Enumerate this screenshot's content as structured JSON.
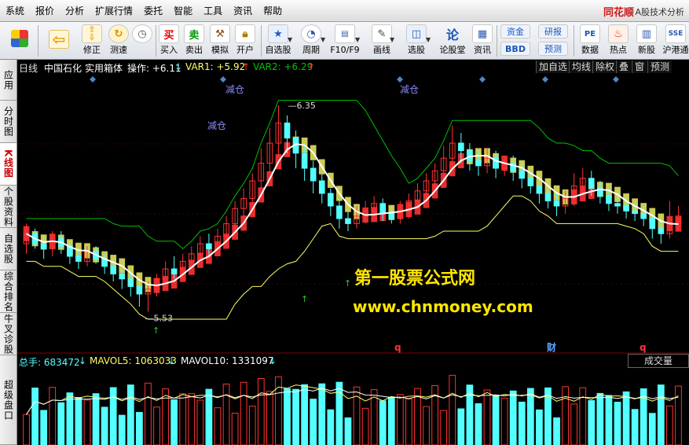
{
  "menu": [
    "系统",
    "报价",
    "分析",
    "扩展行情",
    "委托",
    "智能",
    "工具",
    "资讯",
    "帮助"
  ],
  "brand": {
    "name": "同花顺",
    "subtitle": "- A股技术分析"
  },
  "toolbar": [
    {
      "label": "",
      "icon": "grid-icon"
    },
    {
      "label": "",
      "icon": "back-arrow-icon"
    },
    {
      "label": "修正",
      "icon": "up-down-arrow-icon"
    },
    {
      "label": "测速",
      "icon": "refresh-icon"
    },
    {
      "label": "",
      "icon": "clock-icon"
    },
    {
      "label": "买入",
      "icon": "buy-icon",
      "glyph": "买"
    },
    {
      "label": "卖出",
      "icon": "sell-icon",
      "glyph": "卖"
    },
    {
      "label": "模拟",
      "icon": "hammer-icon"
    },
    {
      "label": "开户",
      "icon": "lock-icon"
    },
    {
      "label": "自选股",
      "icon": "star-icon"
    },
    {
      "label": "周期",
      "icon": "period-icon"
    },
    {
      "label": "F10/F9",
      "icon": "f10-icon"
    },
    {
      "label": "画线",
      "icon": "pen-icon"
    },
    {
      "label": "选股",
      "icon": "stock-picker-icon"
    },
    {
      "label": "论股堂",
      "icon": "forum-icon",
      "glyph": "论"
    },
    {
      "label": "资讯",
      "icon": "news-icon"
    },
    {
      "label": "资金",
      "icon": "funds-icon"
    },
    {
      "label": "BBD",
      "icon": "bbd-icon"
    },
    {
      "label": "研报",
      "icon": "research-icon"
    },
    {
      "label": "预测",
      "icon": "forecast-icon"
    },
    {
      "label": "数据",
      "icon": "pe-data-icon",
      "glyph": "PE"
    },
    {
      "label": "热点",
      "icon": "hot-icon"
    },
    {
      "label": "新股",
      "icon": "new-stock-icon"
    },
    {
      "label": "沪港通",
      "icon": "hk-connect-icon"
    }
  ],
  "left_tabs": [
    {
      "label": "应用"
    },
    {
      "label": "分时图"
    },
    {
      "label": "K线图",
      "active": true
    },
    {
      "label": "个股资料"
    },
    {
      "label": "自选股"
    },
    {
      "label": "综合排名"
    },
    {
      "label": "牛叉诊股"
    },
    {
      "label": "超级盘口"
    }
  ],
  "chart": {
    "period": "日线",
    "stock_name": "中国石化",
    "indicator": "实用箱体",
    "operation": "操作: +6.11",
    "var1": "VAR1: +5.92",
    "var2": "VAR2: +6.29",
    "buttons": [
      "加自选",
      "均线",
      "除权",
      "叠",
      "窗",
      "预测"
    ],
    "high_label": "6.35",
    "low_label": "5.53",
    "annotations": [
      "减仓",
      "减仓",
      "减仓"
    ],
    "events": [
      "q",
      "财",
      "q"
    ],
    "colors": {
      "up": "#ff3232",
      "down": "#54ffff",
      "ma": "#ffffff",
      "box": "#ffff66",
      "var2": "#00c000"
    }
  },
  "chart_data": {
    "type": "candlestick",
    "price_range": [
      5.4,
      6.45
    ],
    "candles": [
      [
        5.8,
        5.84,
        5.76,
        5.88
      ],
      [
        5.84,
        5.8,
        5.78,
        5.86
      ],
      [
        5.8,
        5.78,
        5.74,
        5.83
      ],
      [
        5.78,
        5.82,
        5.75,
        5.85
      ],
      [
        5.82,
        5.79,
        5.76,
        5.85
      ],
      [
        5.79,
        5.75,
        5.72,
        5.81
      ],
      [
        5.75,
        5.73,
        5.7,
        5.78
      ],
      [
        5.73,
        5.77,
        5.71,
        5.79
      ],
      [
        5.77,
        5.74,
        5.72,
        5.79
      ],
      [
        5.74,
        5.71,
        5.68,
        5.76
      ],
      [
        5.71,
        5.68,
        5.65,
        5.74
      ],
      [
        5.68,
        5.66,
        5.62,
        5.7
      ],
      [
        5.66,
        5.63,
        5.59,
        5.69
      ],
      [
        5.63,
        5.6,
        5.55,
        5.66
      ],
      [
        5.6,
        5.62,
        5.53,
        5.65
      ],
      [
        5.62,
        5.66,
        5.59,
        5.68
      ],
      [
        5.66,
        5.7,
        5.63,
        5.73
      ],
      [
        5.7,
        5.68,
        5.66,
        5.75
      ],
      [
        5.68,
        5.73,
        5.66,
        5.76
      ],
      [
        5.73,
        5.76,
        5.7,
        5.79
      ],
      [
        5.76,
        5.8,
        5.73,
        5.83
      ],
      [
        5.8,
        5.78,
        5.75,
        5.84
      ],
      [
        5.78,
        5.83,
        5.76,
        5.86
      ],
      [
        5.83,
        5.88,
        5.8,
        5.91
      ],
      [
        5.88,
        5.94,
        5.85,
        5.97
      ],
      [
        5.94,
        5.98,
        5.9,
        6.02
      ],
      [
        5.98,
        6.05,
        5.95,
        6.08
      ],
      [
        6.05,
        6.12,
        6.02,
        6.18
      ],
      [
        6.12,
        6.2,
        6.08,
        6.26
      ],
      [
        6.2,
        6.28,
        6.15,
        6.35
      ],
      [
        6.28,
        6.22,
        6.16,
        6.31
      ],
      [
        6.22,
        6.16,
        6.1,
        6.25
      ],
      [
        6.16,
        6.1,
        6.05,
        6.19
      ],
      [
        6.1,
        6.05,
        6.0,
        6.13
      ],
      [
        6.05,
        6.0,
        5.96,
        6.08
      ],
      [
        6.0,
        5.95,
        5.91,
        6.02
      ],
      [
        5.95,
        5.9,
        5.86,
        5.98
      ],
      [
        5.9,
        5.88,
        5.85,
        5.93
      ],
      [
        5.88,
        5.91,
        5.86,
        5.95
      ],
      [
        5.91,
        5.93,
        5.88,
        5.97
      ],
      [
        5.93,
        5.96,
        5.9,
        5.99
      ],
      [
        5.96,
        5.92,
        5.89,
        5.98
      ],
      [
        5.92,
        5.9,
        5.88,
        5.95
      ],
      [
        5.9,
        5.93,
        5.88,
        5.97
      ],
      [
        5.93,
        5.97,
        5.9,
        6.0
      ],
      [
        5.97,
        6.01,
        5.94,
        6.04
      ],
      [
        6.01,
        6.05,
        5.98,
        6.08
      ],
      [
        6.05,
        6.09,
        6.02,
        6.12
      ],
      [
        6.09,
        6.14,
        6.06,
        6.19
      ],
      [
        6.14,
        6.2,
        6.1,
        6.27
      ],
      [
        6.2,
        6.17,
        6.12,
        6.24
      ],
      [
        6.17,
        6.13,
        6.09,
        6.2
      ],
      [
        6.13,
        6.11,
        6.07,
        6.17
      ],
      [
        6.11,
        6.14,
        6.08,
        6.18
      ],
      [
        6.14,
        6.1,
        6.06,
        6.17
      ],
      [
        6.1,
        6.12,
        6.07,
        6.15
      ],
      [
        6.12,
        6.09,
        6.05,
        6.15
      ],
      [
        6.09,
        6.06,
        6.02,
        6.12
      ],
      [
        6.06,
        6.03,
        6.0,
        6.09
      ],
      [
        6.03,
        6.0,
        5.96,
        6.06
      ],
      [
        6.0,
        5.97,
        5.94,
        6.02
      ],
      [
        5.97,
        5.95,
        5.91,
        6.0
      ],
      [
        5.95,
        5.98,
        5.92,
        6.01
      ],
      [
        5.98,
        6.03,
        5.95,
        6.08
      ],
      [
        6.03,
        6.06,
        6.0,
        6.1
      ],
      [
        6.06,
        6.02,
        5.99,
        6.09
      ],
      [
        6.02,
        5.99,
        5.96,
        6.05
      ],
      [
        5.99,
        5.96,
        5.93,
        6.02
      ],
      [
        5.96,
        5.95,
        5.92,
        5.99
      ],
      [
        5.95,
        5.93,
        5.9,
        5.98
      ],
      [
        5.93,
        5.92,
        5.89,
        5.96
      ],
      [
        5.92,
        5.9,
        5.87,
        5.95
      ],
      [
        5.9,
        5.86,
        5.82,
        5.92
      ],
      [
        5.86,
        5.84,
        5.8,
        5.9
      ],
      [
        5.84,
        5.88,
        5.82,
        5.97
      ],
      [
        5.88,
        5.91,
        5.85,
        5.95
      ]
    ],
    "volume_range": [
      0,
      3200000
    ],
    "volume": {
      "total": "总手: 683472",
      "mavol5": "MAVOL5: 1063033",
      "mavol10": "MAVOL10: 1331097",
      "button": "成交量"
    }
  },
  "watermark": {
    "line1": "第一股票公式网",
    "line2": "www.chnmoney.com"
  }
}
